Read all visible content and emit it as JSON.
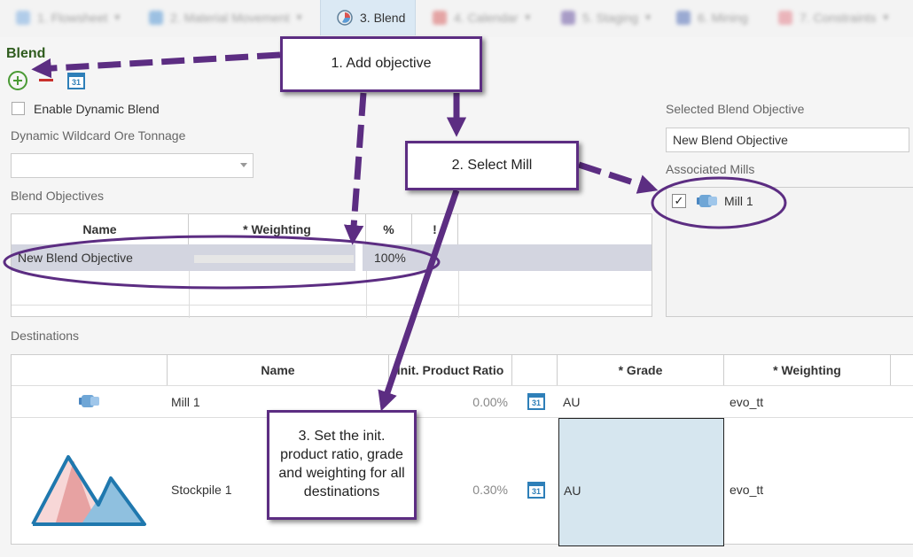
{
  "tabs": [
    {
      "label": "1. Flowsheet"
    },
    {
      "label": "2. Material Movement"
    },
    {
      "label": "3. Blend"
    },
    {
      "label": "4. Calendar"
    },
    {
      "label": "5. Staging"
    },
    {
      "label": "6. Mining"
    },
    {
      "label": "7. Constraints"
    }
  ],
  "blend": {
    "title": "Blend",
    "enable_dynamic_label": "Enable Dynamic Blend",
    "wildcard_label": "Dynamic Wildcard Ore Tonnage",
    "objectives_label": "Blend Objectives",
    "calendar_day": "31",
    "objectives": {
      "columns": [
        "Name",
        "* Weighting",
        "%",
        "!"
      ],
      "rows": [
        {
          "name": "New Blend Objective",
          "weighting_fill": 0.98,
          "percent": "100%"
        }
      ]
    },
    "selected_objective_label": "Selected Blend Objective",
    "selected_objective_value": "New Blend Objective",
    "associated_mills_label": "Associated Mills",
    "mill_check_mark": "✓",
    "mills": [
      {
        "name": "Mill 1",
        "checked": true
      }
    ]
  },
  "destinations": {
    "label": "Destinations",
    "columns": [
      "Name",
      "Init. Product Ratio",
      "* Grade",
      "* Weighting"
    ],
    "rows": [
      {
        "name": "Mill 1",
        "ratio": "0.00%",
        "grade": "AU",
        "weighting": "evo_tt",
        "icon": "mill-icon"
      },
      {
        "name": "Stockpile 1",
        "ratio": "0.30%",
        "grade": "AU",
        "weighting": "evo_tt",
        "icon": "stockpile-icon"
      }
    ]
  },
  "callouts": {
    "add_objective": "1. Add objective",
    "select_mill": "2. Select Mill",
    "set_ratio": "3. Set the init. product ratio, grade and weighting for all destinations"
  },
  "colors": {
    "callout_border": "#5c2d82",
    "title_green": "#2f5c1e",
    "active_tab": "#dbe9f4",
    "selected_row": "#d3d5e0",
    "grade_selected": "#d6e6ef"
  }
}
